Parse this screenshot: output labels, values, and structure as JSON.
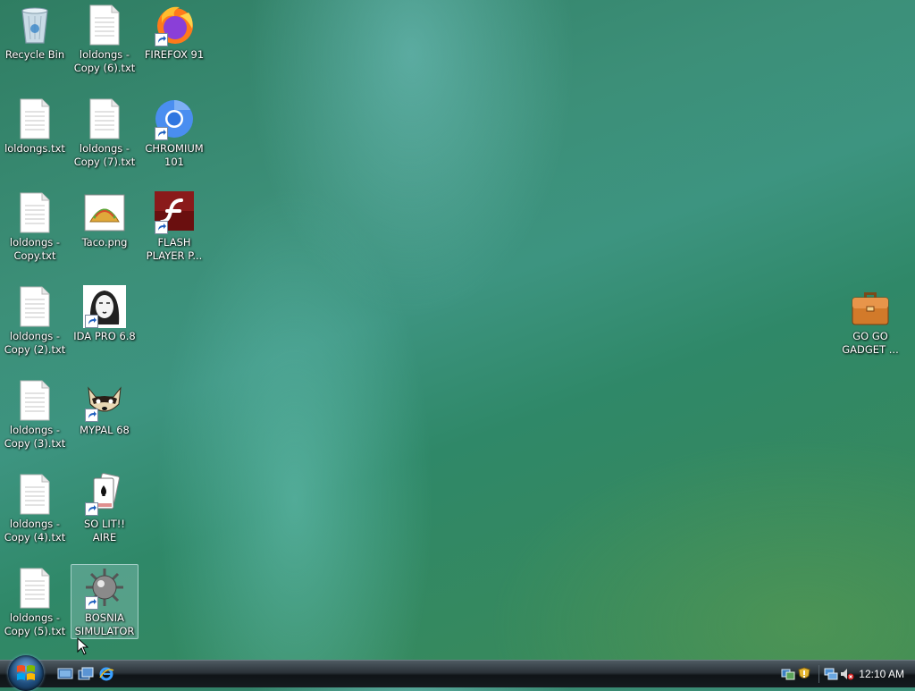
{
  "desktop": {
    "icons": [
      {
        "name": "recycle-bin-icon",
        "label": "Recycle Bin"
      },
      {
        "name": "text-file-icon",
        "label": "loldongs - Copy (6).txt"
      },
      {
        "name": "firefox-icon",
        "label": "FIREFOX 91"
      },
      {
        "name": "text-file-icon",
        "label": "loldongs.txt"
      },
      {
        "name": "text-file-icon",
        "label": "loldongs - Copy (7).txt"
      },
      {
        "name": "chromium-icon",
        "label": "CHROMIUM 101"
      },
      {
        "name": "text-file-icon",
        "label": "loldongs - Copy.txt"
      },
      {
        "name": "taco-image-icon",
        "label": "Taco.png"
      },
      {
        "name": "flash-player-icon",
        "label": "FLASH PLAYER P..."
      },
      {
        "name": "text-file-icon",
        "label": "loldongs - Copy (2).txt"
      },
      {
        "name": "ida-pro-icon",
        "label": "IDA PRO 6.8"
      },
      {
        "name": "gadget-briefcase-icon",
        "label": "GO GO GADGET ..."
      },
      {
        "name": "text-file-icon",
        "label": "loldongs - Copy (3).txt"
      },
      {
        "name": "mypal-raccoon-icon",
        "label": "MYPAL 68"
      },
      {
        "name": "text-file-icon",
        "label": "loldongs - Copy (4).txt"
      },
      {
        "name": "solitaire-cards-icon",
        "label": "SO LIT!! AIRE"
      },
      {
        "name": "text-file-icon",
        "label": "loldongs - Copy (5).txt"
      },
      {
        "name": "minesweeper-mine-icon",
        "label": "BOSNIA SIMULATOR"
      }
    ]
  },
  "taskbar": {
    "start_button": "start-orb-icon",
    "quick_launch": [
      "show-desktop-icon",
      "switch-windows-icon",
      "internet-explorer-icon"
    ],
    "tray_icons": [
      "network-sync-icon",
      "security-shield-icon",
      "network-icon",
      "volume-muted-icon"
    ],
    "clock": "12:10 AM"
  }
}
